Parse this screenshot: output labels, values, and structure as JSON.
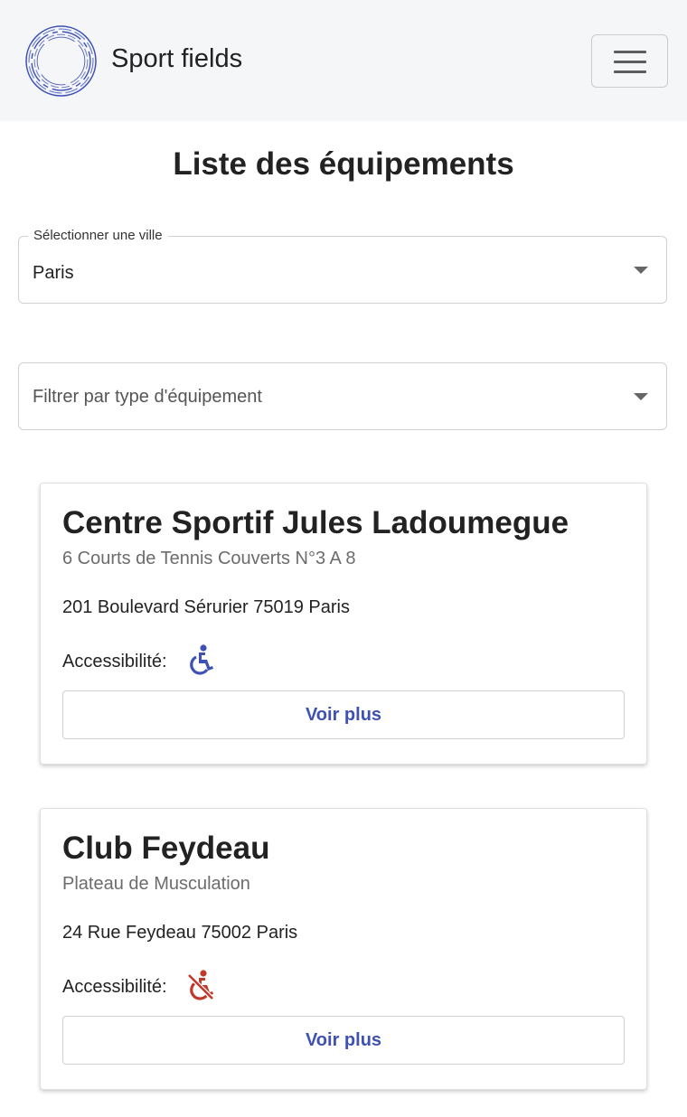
{
  "navbar": {
    "brand": "Sport fields",
    "logo_icon": "circular-ring-logo",
    "menu_icon": "hamburger-menu-icon"
  },
  "page": {
    "title": "Liste des équipements"
  },
  "filters": {
    "city": {
      "label": "Sélectionner une ville",
      "value": "Paris"
    },
    "equipment_type": {
      "placeholder": "Filtrer par type d'équipement"
    }
  },
  "equipments": [
    {
      "name": "Centre Sportif Jules Ladoumegue",
      "type": "6 Courts de Tennis Couverts N°3 A 8",
      "address": "201 Boulevard Sérurier 75019 Paris",
      "accessibility_label": "Accessibilité:",
      "accessible": true,
      "accessibility_icon": "wheelchair-accessible-icon",
      "accessibility_color": "#3f51b5",
      "button": "Voir plus"
    },
    {
      "name": "Club Feydeau",
      "type": "Plateau de Musculation",
      "address": "24 Rue Feydeau 75002 Paris",
      "accessibility_label": "Accessibilité:",
      "accessible": false,
      "accessibility_icon": "not-accessible-icon",
      "accessibility_color": "#c0392b",
      "button": "Voir plus"
    }
  ],
  "colors": {
    "navbar_bg": "#f5f6f8",
    "accent": "#3f51b5",
    "not_accessible": "#c0392b"
  }
}
